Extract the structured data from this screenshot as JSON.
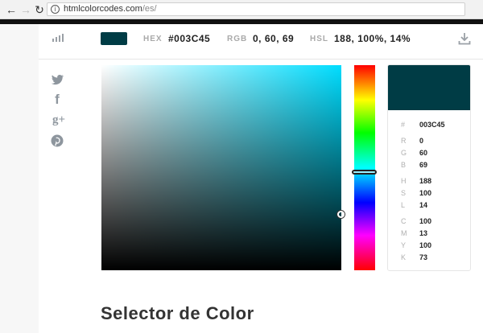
{
  "browser": {
    "back_icon": "arrow-left-icon",
    "forward_icon": "arrow-right-icon",
    "reload_icon": "reload-icon",
    "info_icon": "info-icon",
    "url_host": "htmlcolorcodes.com",
    "url_path": "/es/"
  },
  "toolbar": {
    "hex_label": "HEX",
    "hex_value": "#003C45",
    "rgb_label": "RGB",
    "rgb_value": "0, 60, 69",
    "hsl_label": "HSL",
    "hsl_value": "188, 100%, 14%",
    "color": "#003C45"
  },
  "social": [
    "twitter-icon",
    "facebook-icon",
    "google-plus-icon",
    "pinterest-icon"
  ],
  "card": {
    "color": "#003C45",
    "hex": {
      "k": "#",
      "v": "003C45"
    },
    "r": {
      "k": "R",
      "v": "0"
    },
    "g": {
      "k": "G",
      "v": "60"
    },
    "b": {
      "k": "B",
      "v": "69"
    },
    "h": {
      "k": "H",
      "v": "188"
    },
    "s": {
      "k": "S",
      "v": "100"
    },
    "l": {
      "k": "L",
      "v": "14"
    },
    "c": {
      "k": "C",
      "v": "100"
    },
    "m": {
      "k": "M",
      "v": "13"
    },
    "y": {
      "k": "Y",
      "v": "100"
    },
    "kk": {
      "k": "K",
      "v": "73"
    }
  },
  "heading": "Selector de Color"
}
